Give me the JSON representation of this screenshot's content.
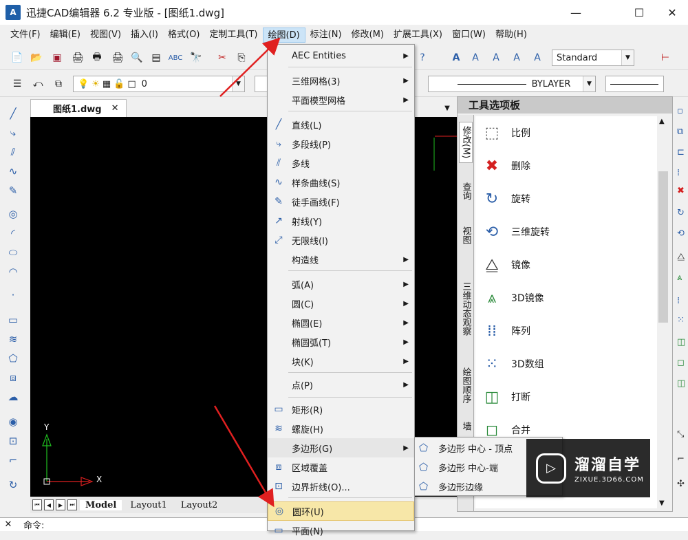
{
  "window": {
    "title": "迅捷CAD编辑器 6.2 专业版 - [图纸1.dwg]",
    "app_icon_text": "A",
    "minimize": "—",
    "maximize": "☐",
    "close": "✕"
  },
  "menubar": [
    "文件(F)",
    "编辑(E)",
    "视图(V)",
    "插入(I)",
    "格式(O)",
    "定制工具(T)",
    "绘图(D)",
    "标注(N)",
    "修改(M)",
    "扩展工具(X)",
    "窗口(W)",
    "帮助(H)"
  ],
  "toolbar": {
    "text_style": "Standard",
    "layer_value": "0",
    "linetype": "BYLAYER"
  },
  "document": {
    "tab_label": "图纸1.dwg",
    "tab_close": "✕",
    "layout_tabs": [
      "Model",
      "Layout1",
      "Layout2"
    ],
    "axis_y": "Y",
    "axis_x": "X"
  },
  "command": {
    "prompt": "命令:"
  },
  "draw_menu": {
    "items": [
      {
        "label": "AEC Entities",
        "icon": "",
        "sub": true
      },
      {
        "label": "三维网格(3)",
        "icon": "",
        "sub": true
      },
      {
        "label": "平面模型网格",
        "icon": "",
        "sub": true
      },
      {
        "label": "直线(L)",
        "icon": "line-icon",
        "sub": false
      },
      {
        "label": "多段线(P)",
        "icon": "polyline-icon",
        "sub": false
      },
      {
        "label": "多线",
        "icon": "multiline-icon",
        "sub": false
      },
      {
        "label": "样条曲线(S)",
        "icon": "spline-icon",
        "sub": false
      },
      {
        "label": "徒手画线(F)",
        "icon": "freehand-icon",
        "sub": false
      },
      {
        "label": "射线(Y)",
        "icon": "ray-icon",
        "sub": false
      },
      {
        "label": "无限线(I)",
        "icon": "xline-icon",
        "sub": false
      },
      {
        "label": "构造线",
        "icon": "",
        "sub": true
      },
      {
        "label": "弧(A)",
        "icon": "",
        "sub": true
      },
      {
        "label": "圆(C)",
        "icon": "",
        "sub": true
      },
      {
        "label": "椭圆(E)",
        "icon": "",
        "sub": true
      },
      {
        "label": "椭圆弧(T)",
        "icon": "",
        "sub": true
      },
      {
        "label": "块(K)",
        "icon": "",
        "sub": true
      },
      {
        "label": "点(P)",
        "icon": "",
        "sub": true
      },
      {
        "label": "矩形(R)",
        "icon": "rectangle-icon",
        "sub": false
      },
      {
        "label": "螺旋(H)",
        "icon": "helix-icon",
        "sub": false
      },
      {
        "label": "多边形(G)",
        "icon": "",
        "sub": true
      },
      {
        "label": "区域覆盖",
        "icon": "wipeout-icon",
        "sub": false
      },
      {
        "label": "边界折线(O)...",
        "icon": "boundary-icon",
        "sub": false
      },
      {
        "label": "圆环(U)",
        "icon": "donut-icon",
        "sub": false,
        "highlighted": true
      },
      {
        "label": "平面(N)",
        "icon": "plane-icon",
        "sub": false
      }
    ]
  },
  "polygon_submenu": [
    "多边形 中心 - 顶点",
    "多边形 中心-端",
    "多边形边缘"
  ],
  "palette": {
    "title": "工具选项板",
    "tabs": [
      "修改(M)",
      "查询",
      "视图",
      "三维动态观察",
      "绘图顺序",
      "墙"
    ],
    "items": [
      {
        "label": "比例",
        "icon": "scale-icon"
      },
      {
        "label": "删除",
        "icon": "delete-icon"
      },
      {
        "label": "旋转",
        "icon": "rotate-icon"
      },
      {
        "label": "三维旋转",
        "icon": "rotate3d-icon"
      },
      {
        "label": "镜像",
        "icon": "mirror-icon"
      },
      {
        "label": "3D镜像",
        "icon": "mirror3d-icon"
      },
      {
        "label": "阵列",
        "icon": "array-icon"
      },
      {
        "label": "3D数组",
        "icon": "array3d-icon"
      },
      {
        "label": "打断",
        "icon": "break-icon"
      },
      {
        "label": "合并",
        "icon": "join-icon"
      }
    ]
  },
  "watermark": {
    "title": "溜溜自学",
    "url": "ZIXUE.3D66.COM"
  },
  "colors": {
    "accent": "#2b5ea8",
    "highlight": "#f7e7a8",
    "annotation_arrow": "#e02020",
    "canvas": "#000000"
  }
}
